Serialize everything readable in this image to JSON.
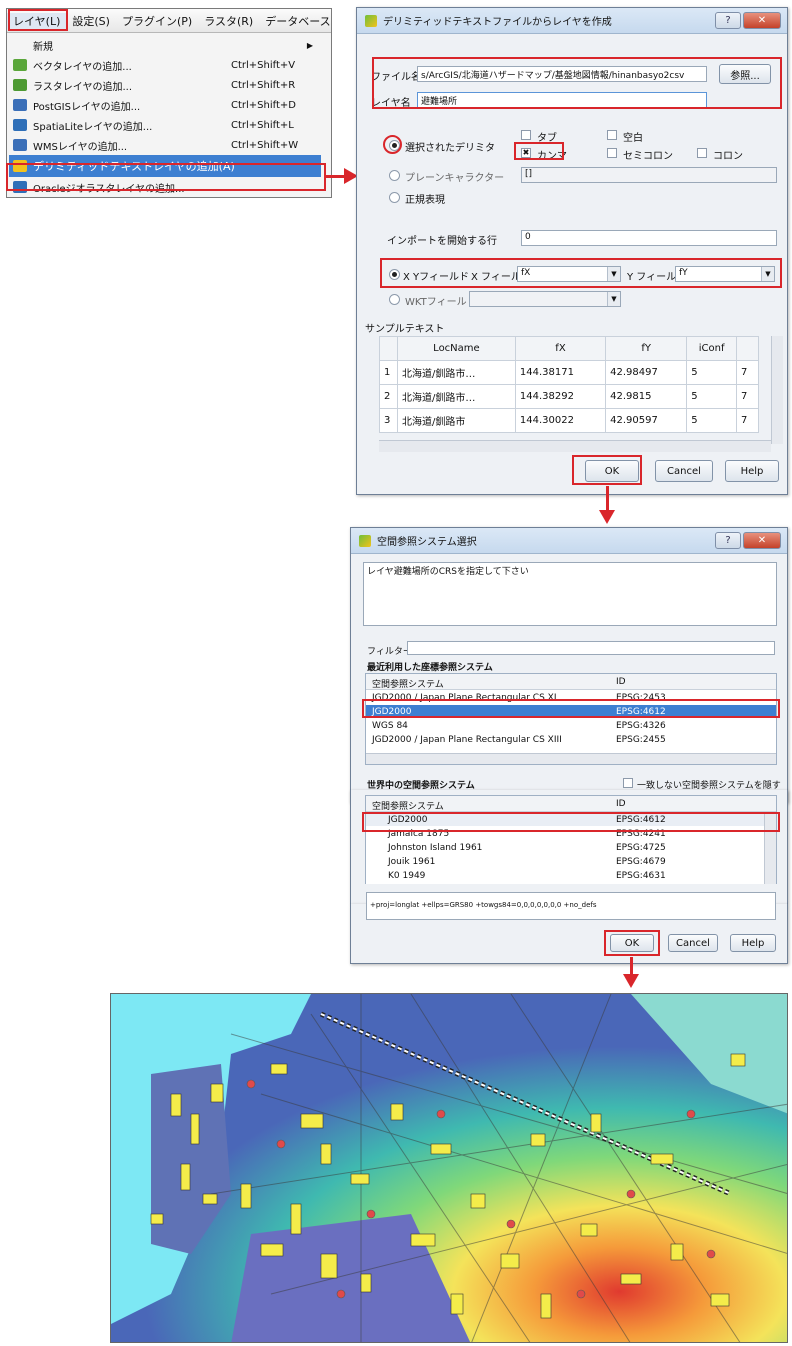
{
  "menu": {
    "bar": [
      "レイヤ(L)",
      "設定(S)",
      "プラグイン(P)",
      "ラスタ(R)",
      "データベース(D"
    ],
    "items": [
      {
        "label": "新規",
        "shortcut": "",
        "has_submenu": true
      },
      {
        "label": "ベクタレイヤの追加...",
        "shortcut": "Ctrl+Shift+V"
      },
      {
        "label": "ラスタレイヤの追加...",
        "shortcut": "Ctrl+Shift+R"
      },
      {
        "label": "PostGISレイヤの追加...",
        "shortcut": "Ctrl+Shift+D"
      },
      {
        "label": "SpatiaLiteレイヤの追加...",
        "shortcut": "Ctrl+Shift+L"
      },
      {
        "label": "WMSレイヤの追加...",
        "shortcut": "Ctrl+Shift+W"
      },
      {
        "label": "デリミティッドテキストレイヤの追加(A)",
        "shortcut": ""
      },
      {
        "label": "Oracleジオラスタレイヤの追加...",
        "shortcut": ""
      }
    ],
    "icon_colors": [
      "#9a9a9a",
      "#5aa63a",
      "#5aa63a",
      "#3b6fb8",
      "#3b6fb8",
      "#3b6fb8",
      "#4d8fd6",
      "#2f6fb8"
    ]
  },
  "delim_dialog": {
    "title": "デリミティッドテキストファイルからレイヤを作成",
    "file_label": "ファイル名",
    "file_value": "s/ArcGIS/北海道ハザードマップ/基盤地図情報/hinanbasyo2csv",
    "browse_button": "参照...",
    "layer_label": "レイヤ名",
    "layer_value": "避難場所",
    "radio_selected_delim": "選択されたデリミタ",
    "radio_plain": "プレーンキャラクター",
    "radio_regex": "正規表現",
    "cb_tab": "タブ",
    "cb_comma": "カンマ",
    "cb_space": "空白",
    "cb_semicolon": "セミコロン",
    "cb_colon": "コロン",
    "plain_value": "[]",
    "import_label": "インポートを開始する行",
    "import_value": "0",
    "xy_radio": "X Yフィールド",
    "x_field_label": "X フィールド",
    "x_field_value": "fX",
    "y_field_label": "Y フィールド",
    "y_field_value": "fY",
    "wkt_radio": "WKTフィールド",
    "sample_label": "サンプルテキスト",
    "sample_headers": [
      "LocName",
      "fX",
      "fY",
      "iConf"
    ],
    "sample_rows": [
      {
        "n": "1",
        "cells": [
          "北海道/釧路市…",
          "144.38171",
          "42.98497",
          "5",
          "7"
        ]
      },
      {
        "n": "2",
        "cells": [
          "北海道/釧路市…",
          "144.38292",
          "42.9815",
          "5",
          "7"
        ]
      },
      {
        "n": "3",
        "cells": [
          "北海道/釧路市",
          "144.30022",
          "42.90597",
          "5",
          "7"
        ]
      }
    ],
    "ok": "OK",
    "cancel": "Cancel",
    "help": "Help"
  },
  "crs_dialog": {
    "title": "空間参照システム選択",
    "message": "レイヤ避難場所のCRSを指定して下さい",
    "filter_label": "フィルター",
    "recent_heading": "最近利用した座標参照システム",
    "col_name": "空間参照システム",
    "col_id": "ID",
    "recent_rows": [
      {
        "name": "JGD2000 / Japan Plane Rectangular CS XI",
        "id": "EPSG:2453"
      },
      {
        "name": "JGD2000",
        "id": "EPSG:4612"
      },
      {
        "name": "WGS 84",
        "id": "EPSG:4326"
      },
      {
        "name": "JGD2000 / Japan Plane Rectangular CS XIII",
        "id": "EPSG:2455"
      }
    ],
    "world_heading": "世界中の空間参照システム",
    "hide_label": "一致しない空間参照システムを隠す",
    "world_rows": [
      {
        "name": "JGD2000",
        "id": "EPSG:4612"
      },
      {
        "name": "Jamaica 1875",
        "id": "EPSG:4241"
      },
      {
        "name": "Johnston Island 1961",
        "id": "EPSG:4725"
      },
      {
        "name": "Jouik 1961",
        "id": "EPSG:4679"
      },
      {
        "name": "K0 1949",
        "id": "EPSG:4631"
      }
    ],
    "proj_string": "+proj=longlat +ellps=GRS80 +towgs84=0,0,0,0,0,0,0 +no_defs",
    "ok": "OK",
    "cancel": "Cancel",
    "help": "Help"
  },
  "colors": {
    "highlight": "#d9262b",
    "selection": "#3d7fd1",
    "water": "#7de8f4",
    "building": "#f4ec4a"
  }
}
